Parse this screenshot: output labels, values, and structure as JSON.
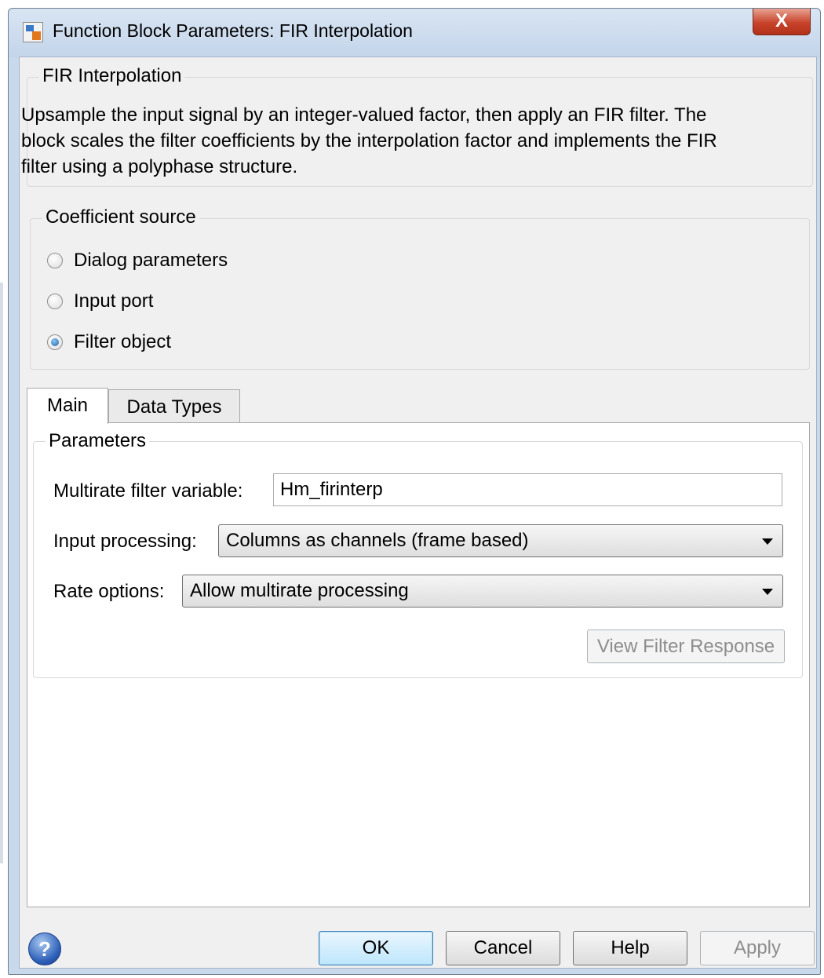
{
  "window": {
    "title": "Function Block Parameters: FIR Interpolation",
    "close_label": "X"
  },
  "header": {
    "legend": "FIR Interpolation",
    "description_lines": [
      "Upsample the input signal by an integer-valued factor, then apply an FIR filter. The",
      "block scales the filter coefficients by the interpolation factor and implements the FIR",
      "filter using a polyphase structure."
    ]
  },
  "coefficient_source": {
    "legend": "Coefficient source",
    "options": [
      {
        "label": "Dialog parameters",
        "checked": false
      },
      {
        "label": "Input port",
        "checked": false
      },
      {
        "label": "Filter object",
        "checked": true
      }
    ]
  },
  "tabs": [
    {
      "label": "Main",
      "active": true
    },
    {
      "label": "Data Types",
      "active": false
    }
  ],
  "parameters": {
    "legend": "Parameters",
    "multirate_label": "Multirate filter variable:",
    "multirate_value": "Hm_firinterp",
    "input_processing_label": "Input processing:",
    "input_processing_value": "Columns as channels (frame based)",
    "rate_options_label": "Rate options:",
    "rate_options_value": "Allow multirate processing",
    "view_filter_response_label": "View Filter Response"
  },
  "footer": {
    "ok_label": "OK",
    "cancel_label": "Cancel",
    "help_label": "Help",
    "apply_label": "Apply",
    "help_icon_glyph": "?"
  },
  "colors": {
    "frame": "#c9d9ec",
    "close_button": "#c7432a",
    "default_button": "#bee6fd"
  }
}
